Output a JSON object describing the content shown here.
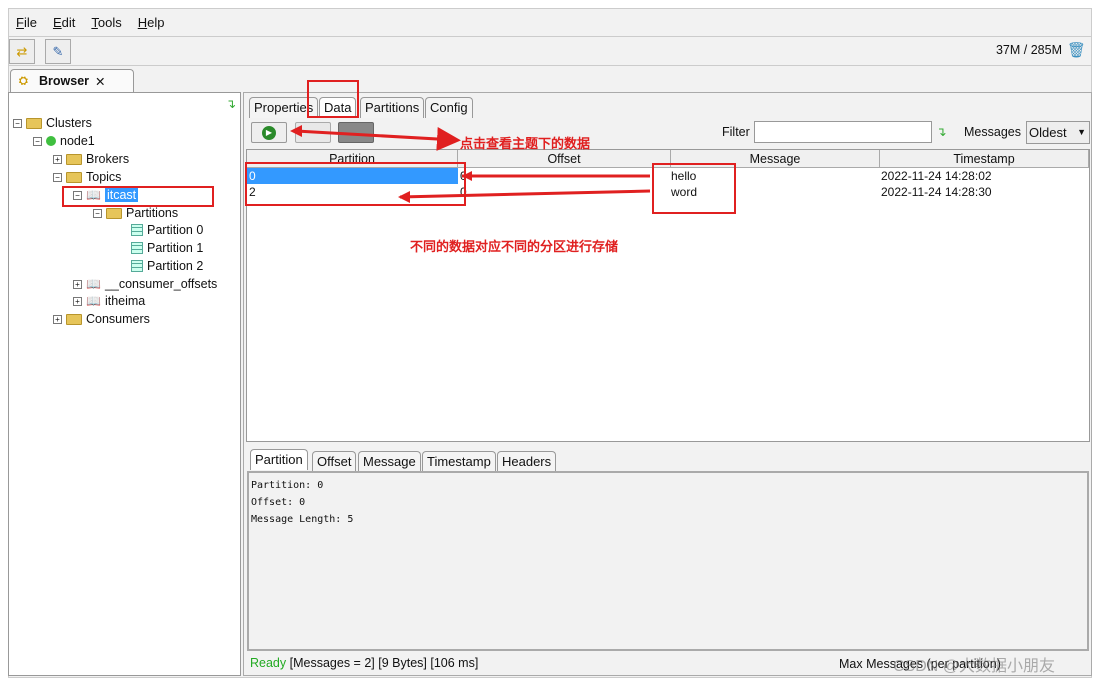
{
  "menu": [
    "File",
    "Edit",
    "Tools",
    "Help"
  ],
  "toolbar": {
    "memory": "37M / 285M",
    "icons": [
      "connect-icon",
      "tree-edit-icon",
      "trash-icon"
    ]
  },
  "browser_tab": {
    "label": "Browser",
    "close": "✕"
  },
  "tree": {
    "clusters": "Clusters",
    "node": "node1",
    "brokers": "Brokers",
    "topics": "Topics",
    "selected_topic": "itcast",
    "partitions": "Partitions",
    "partition_items": [
      "Partition 0",
      "Partition 1",
      "Partition 2"
    ],
    "other_topics": [
      "__consumer_offsets",
      "itheima"
    ],
    "consumers": "Consumers"
  },
  "topic_tabs": [
    "Properties",
    "Data",
    "Partitions",
    "Config"
  ],
  "active_topic_tab": "Data",
  "data_toolbar": {
    "filter_label": "Filter",
    "filter_value": "",
    "messages_label": "Messages",
    "messages_select": "Oldest"
  },
  "table": {
    "columns": [
      "Partition",
      "Offset",
      "Message",
      "Timestamp"
    ],
    "rows": [
      {
        "partition": "0",
        "offset": "0",
        "message": "hello",
        "timestamp": "2022-11-24 14:28:02",
        "selected": true
      },
      {
        "partition": "2",
        "offset": "0",
        "message": "word",
        "timestamp": "2022-11-24 14:28:30",
        "selected": false
      }
    ]
  },
  "detail_tabs": [
    "Partition",
    "Offset",
    "Message",
    "Timestamp",
    "Headers"
  ],
  "detail": {
    "lines": [
      "Partition: 0",
      "Offset: 0",
      "Message Length: 5"
    ]
  },
  "status": {
    "ready": "Ready",
    "messages": "[Messages = 2]",
    "bytes": "[9 Bytes]",
    "time": "[106 ms]",
    "right": "Max Messages (per partition)"
  },
  "annotations": {
    "click_hint": "点击查看主题下的数据",
    "partition_hint": "不同的数据对应不同的分区进行存储",
    "color": "#e02020"
  },
  "watermark": "CSDN @大数据小朋友",
  "colors": {
    "selection": "#3399ff",
    "ready": "#22aa22"
  }
}
